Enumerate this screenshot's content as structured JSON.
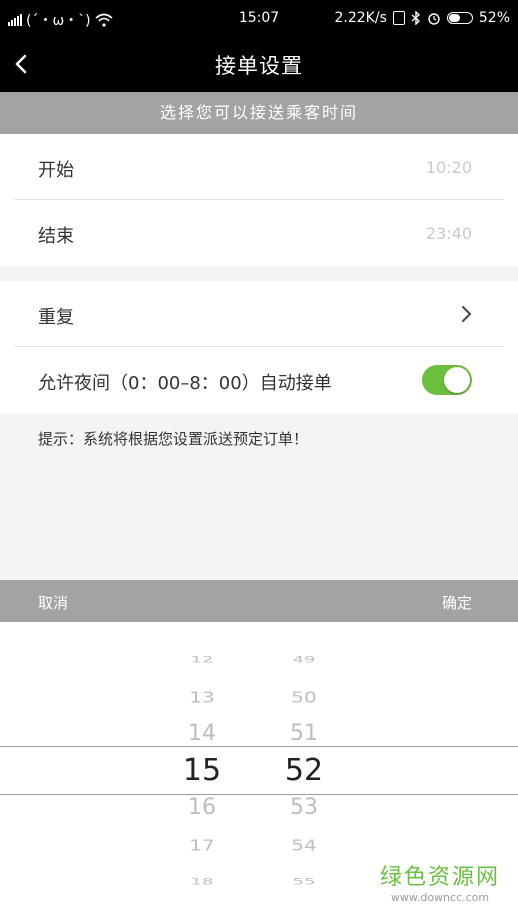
{
  "status_bar": {
    "emoticon": "(´・ω・`)",
    "time": "15:07",
    "speed": "2.22K/s",
    "battery": "52%",
    "battery_level": 0.52,
    "icons": [
      "signal-icon",
      "wifi-icon",
      "sim-icon",
      "bluetooth-icon",
      "alarm-icon",
      "battery-icon"
    ]
  },
  "header": {
    "title": "接单设置",
    "back_icon": "chevron-left-icon"
  },
  "section_header": "选择您可以接送乘客时间",
  "time_rows": [
    {
      "label": "开始",
      "value": "10:20"
    },
    {
      "label": "结束",
      "value": "23:40"
    }
  ],
  "settings": {
    "repeat_label": "重复",
    "night_label": "允许夜间（0：00–8：00）自动接单",
    "night_enabled": true,
    "toggle_color": "#6bbf3d"
  },
  "hint": "提示：系统将根据您设置派送预定订单！",
  "picker_bar": {
    "cancel": "取消",
    "confirm": "确定"
  },
  "picker": {
    "hours": [
      "12",
      "13",
      "14",
      "15",
      "16",
      "17",
      "18"
    ],
    "minutes": [
      "49",
      "50",
      "51",
      "52",
      "53",
      "54",
      "55"
    ],
    "selected_index": 3
  },
  "watermark": {
    "name": "绿色资源网",
    "url": "www.downcc.com"
  }
}
